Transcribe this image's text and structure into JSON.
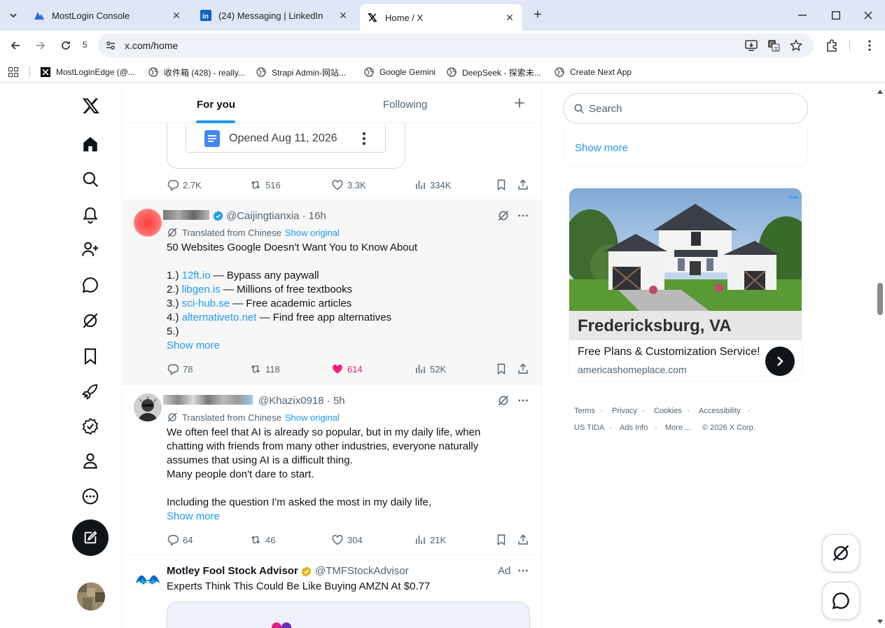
{
  "browser": {
    "tabs": [
      {
        "title": "MostLogin Console",
        "active": false
      },
      {
        "title": "(24) Messaging | LinkedIn",
        "active": false
      },
      {
        "title": "Home / X",
        "active": true
      }
    ],
    "url": "x.com/home",
    "extension_badge": "5",
    "bookmarks": [
      "MostLoginEdge (@...",
      "收件箱 (428) - really...",
      "Strapi Admin-网站...",
      "Google Gemini",
      "DeepSeek - 探索未...",
      "Create Next App"
    ]
  },
  "feed": {
    "tabs": [
      "For you",
      "Following"
    ],
    "active_tab": "For you",
    "top_post": {
      "card_text": "Opened Aug 11, 2026",
      "stats": {
        "replies": "2.7K",
        "reposts": "516",
        "likes": "3.3K",
        "views": "334K"
      }
    },
    "posts": [
      {
        "handle_time": "@Caijingtianxia · 16h",
        "translated_label": "Translated from Chinese",
        "show_original": "Show original",
        "headline": "50 Websites Google Doesn't Want You to Know About",
        "list": [
          {
            "num": "1.)",
            "link": "12ft.io",
            "desc": " — Bypass any paywall"
          },
          {
            "num": "2.)",
            "link": "libgen.is",
            "desc": " — Millions of free textbooks"
          },
          {
            "num": "3.)",
            "link": "sci-hub.se",
            "desc": " — Free academic articles"
          },
          {
            "num": "4.)",
            "link": "alternativeto.net",
            "desc": " — Find free app alternatives"
          },
          {
            "num": "5.)",
            "link": "",
            "desc": ""
          }
        ],
        "show_more": "Show more",
        "stats": {
          "replies": "78",
          "reposts": "118",
          "likes": "614",
          "views": "52K"
        }
      },
      {
        "handle_time": "@Khazix0918 · 5h",
        "translated_label": "Translated from Chinese",
        "show_original": "Show original",
        "lines": [
          "We often feel that AI is already so popular, but in my daily life, when",
          "chatting with friends from many other industries, everyone naturally",
          "assumes that using AI is a difficult thing.",
          "Many people don't dare to start.",
          "",
          "Including the question I'm asked the most in my daily life,"
        ],
        "show_more": "Show more",
        "stats": {
          "replies": "64",
          "reposts": "46",
          "likes": "304",
          "views": "21K"
        }
      },
      {
        "name": "Motley Fool Stock Advisor",
        "handle": "@TMFStockAdvisor",
        "ad_label": "Ad",
        "text": "Experts Think This Could Be Like Buying AMZN At $0.77"
      }
    ]
  },
  "sidebar": {
    "search_placeholder": "Search",
    "show_more": "Show more",
    "ad": {
      "title": "Fredericksburg, VA",
      "subtitle": "Free Plans & Customization Service!",
      "domain": "americashomeplace.com"
    },
    "footer_row1": [
      "Terms",
      "Privacy",
      "Cookies",
      "Accessibility"
    ],
    "footer_row2": [
      "US TIDA",
      "Ads Info",
      "More ...",
      "© 2026 X Corp."
    ]
  },
  "colors": {
    "accent": "#1d9bf0",
    "like_active": "#f91880",
    "text": "#0f1419",
    "muted": "#536471"
  }
}
